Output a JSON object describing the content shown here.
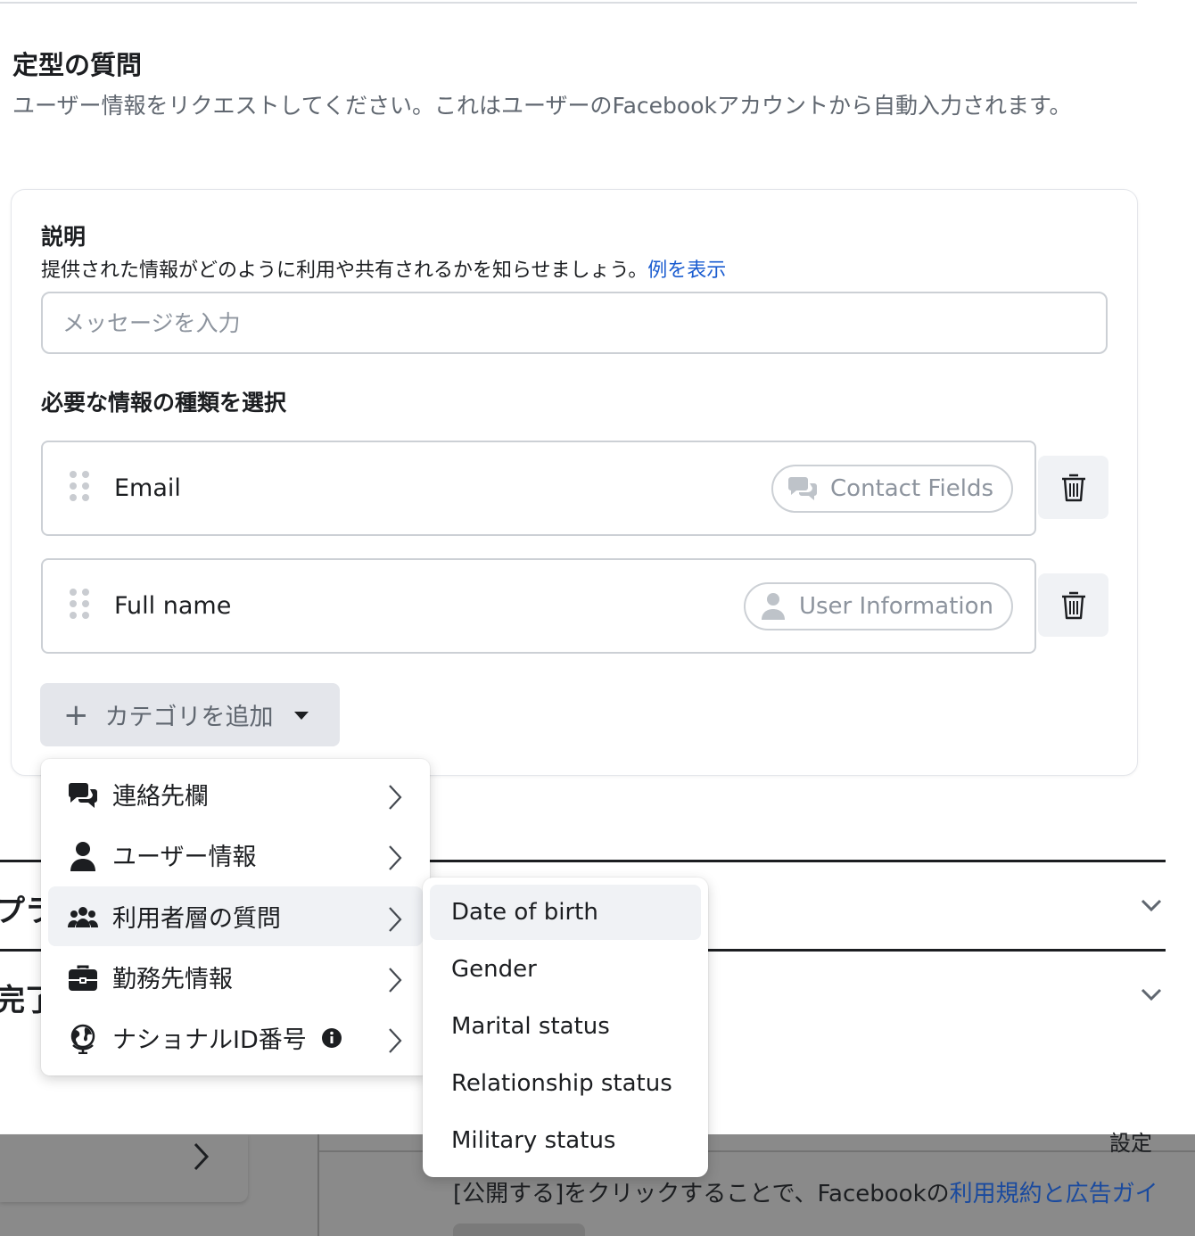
{
  "section": {
    "title": "定型の質問",
    "description": "ユーザー情報をリクエストしてください。これはユーザーのFacebookアカウントから自動入力されます。"
  },
  "card": {
    "description_label": "説明",
    "description_help": "提供された情報がどのように利用や共有されるかを知らせましょう。",
    "example_link": "例を表示",
    "message_placeholder": "メッセージを入力",
    "required_label": "必要な情報の種類を選択",
    "fields": [
      {
        "name": "Email",
        "category": "Contact Fields",
        "category_icon": "chat-bubbles-icon"
      },
      {
        "name": "Full name",
        "category": "User Information",
        "category_icon": "person-icon"
      }
    ],
    "add_category_label": "カテゴリを追加"
  },
  "background_sections": [
    {
      "text": "プラ"
    },
    {
      "text": "完了"
    }
  ],
  "background_footer": {
    "setting_text": "設定",
    "publish_text": "[公開する]をクリックすることで、Facebookの",
    "publish_link": "利用規約と広告ガイ"
  },
  "category_menu": {
    "items": [
      {
        "label": "連絡先欄",
        "icon": "chat-bubbles-icon"
      },
      {
        "label": "ユーザー情報",
        "icon": "person-icon"
      },
      {
        "label": "利用者層の質問",
        "icon": "group-icon",
        "active": true
      },
      {
        "label": "勤務先情報",
        "icon": "briefcase-icon"
      },
      {
        "label": "ナショナルID番号",
        "icon": "globe-icon",
        "has_info": true
      }
    ]
  },
  "submenu": {
    "items": [
      {
        "label": "Date of birth",
        "active": true
      },
      {
        "label": "Gender"
      },
      {
        "label": "Marital status"
      },
      {
        "label": "Relationship status"
      },
      {
        "label": "Military status"
      }
    ]
  },
  "colors": {
    "link": "#1a5cd0",
    "text_primary": "#1c1e21",
    "text_secondary": "#606770",
    "hover_bg": "#f0f2f5",
    "border": "#ccd0d5"
  }
}
